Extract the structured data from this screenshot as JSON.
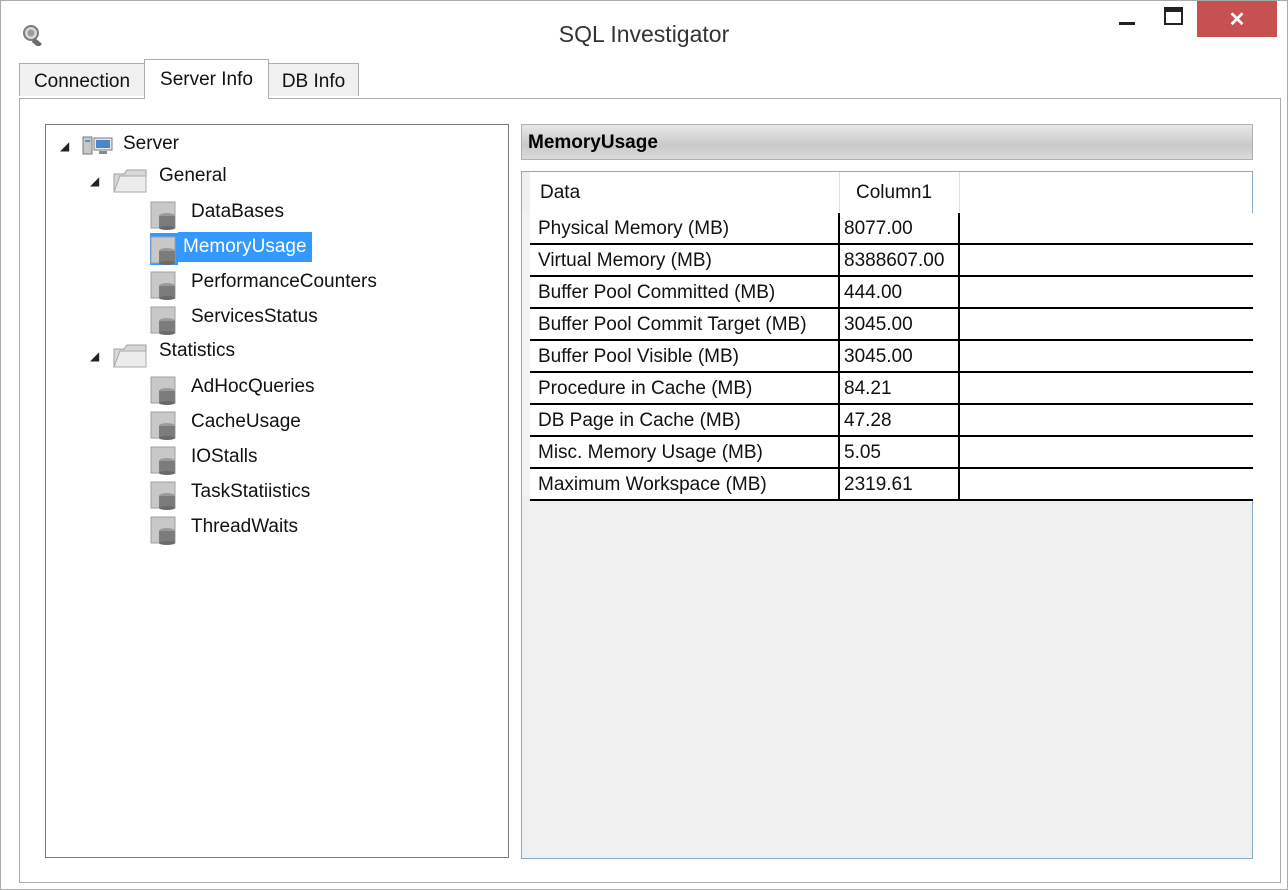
{
  "window": {
    "title": "SQL Investigator",
    "close_glyph": "✕"
  },
  "tabs": [
    {
      "label": "Connection"
    },
    {
      "label": "Server Info"
    },
    {
      "label": "DB Info"
    }
  ],
  "tree": {
    "root": {
      "label": "Server",
      "icon": "server-icon"
    },
    "groups": [
      {
        "label": "General",
        "icon": "folder-icon",
        "items": [
          "DataBases",
          "MemoryUsage",
          "PerformanceCounters",
          "ServicesStatus"
        ]
      },
      {
        "label": "Statistics",
        "icon": "folder-icon",
        "items": [
          "AdHocQueries",
          "CacheUsage",
          "IOStalls",
          "TaskStatiistics",
          "ThreadWaits"
        ]
      }
    ],
    "selected": "MemoryUsage",
    "item_icon": "database-icon"
  },
  "panel": {
    "title": "MemoryUsage",
    "columns": [
      "Data",
      "Column1"
    ],
    "rows": [
      [
        "Physical Memory (MB)",
        "8077.00"
      ],
      [
        "Virtual Memory (MB)",
        "8388607.00"
      ],
      [
        "Buffer Pool Committed (MB)",
        "444.00"
      ],
      [
        "Buffer Pool Commit Target (MB)",
        "3045.00"
      ],
      [
        "Buffer Pool Visible (MB)",
        "3045.00"
      ],
      [
        "Procedure in Cache (MB)",
        "84.21"
      ],
      [
        "DB Page in Cache (MB)",
        "47.28"
      ],
      [
        "Misc. Memory Usage (MB)",
        "5.05"
      ],
      [
        "Maximum Workspace (MB)",
        "2319.61"
      ]
    ]
  },
  "colors": {
    "selection": "#3399ff",
    "close_button": "#c75050"
  }
}
